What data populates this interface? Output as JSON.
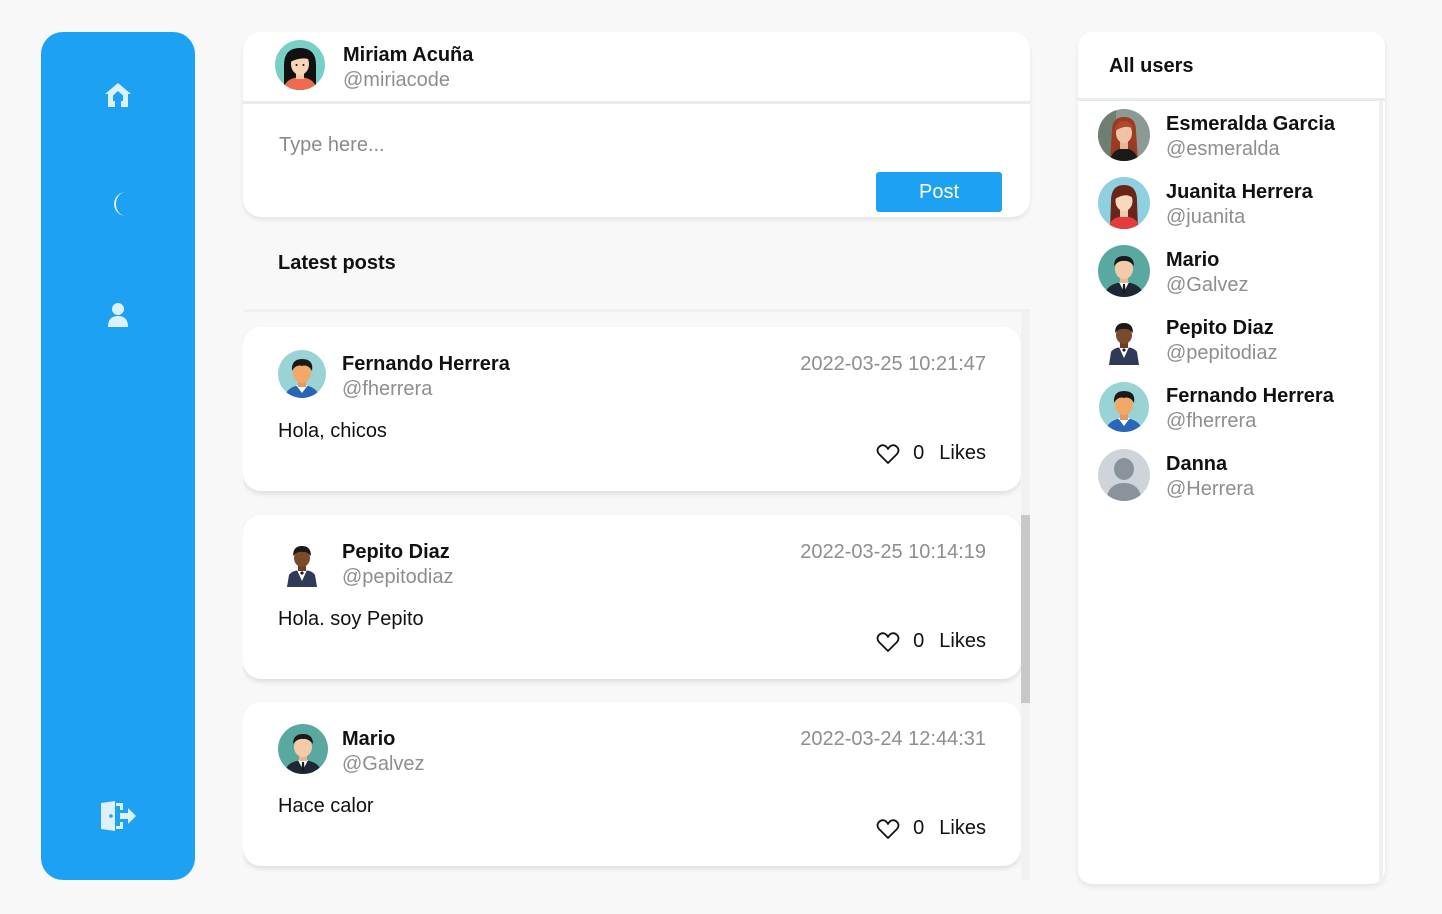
{
  "colors": {
    "accent": "#1da1f2",
    "muted_text": "#8e8e8e",
    "page_bg": "#f8f8f9"
  },
  "sidebar": {
    "items": [
      {
        "icon": "home-icon"
      },
      {
        "icon": "moon-icon"
      },
      {
        "icon": "user-icon"
      },
      {
        "icon": "logout-icon"
      }
    ]
  },
  "composer": {
    "user": {
      "name": "Miriam Acuña",
      "handle": "@miriacode",
      "avatar": "woman-black-hair"
    },
    "placeholder": "Type here...",
    "value": "",
    "post_label": "Post"
  },
  "feed": {
    "title": "Latest posts",
    "posts": [
      {
        "name": "Fernando Herrera",
        "handle": "@fherrera",
        "timestamp": "2022-03-25 10:21:47",
        "body": "Hola, chicos",
        "likes": "0",
        "likes_label": "Likes",
        "avatar": "man-blue-shirt"
      },
      {
        "name": "Pepito Diaz",
        "handle": "@pepitodiaz",
        "timestamp": "2022-03-25 10:14:19",
        "body": "Hola. soy Pepito",
        "likes": "0",
        "likes_label": "Likes",
        "avatar": "man-suit"
      },
      {
        "name": "Mario",
        "handle": "@Galvez",
        "timestamp": "2022-03-24 12:44:31",
        "body": "Hace calor",
        "likes": "0",
        "likes_label": "Likes",
        "avatar": "man-tie-teal"
      }
    ]
  },
  "users_panel": {
    "title": "All users",
    "users": [
      {
        "name": "Esmeralda Garcia",
        "handle": "@esmeralda",
        "avatar": "woman-photo"
      },
      {
        "name": "Juanita Herrera",
        "handle": "@juanita",
        "avatar": "woman-red"
      },
      {
        "name": "Mario",
        "handle": "@Galvez",
        "avatar": "man-tie-teal"
      },
      {
        "name": "Pepito Diaz",
        "handle": "@pepitodiaz",
        "avatar": "man-suit"
      },
      {
        "name": "Fernando Herrera",
        "handle": "@fherrera",
        "avatar": "man-blue-shirt"
      },
      {
        "name": "Danna",
        "handle": "@Herrera",
        "avatar": "default-avatar"
      }
    ]
  }
}
